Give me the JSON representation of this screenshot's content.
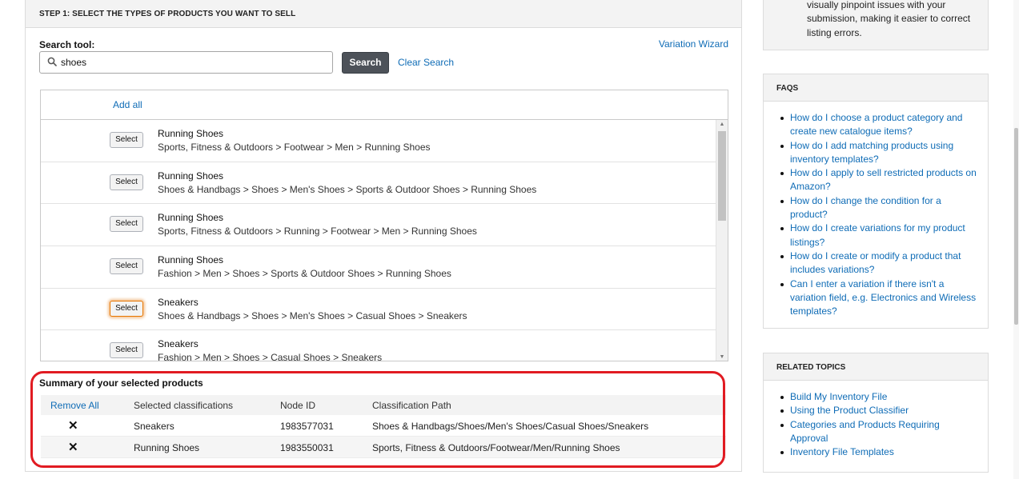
{
  "step": {
    "header": "STEP 1: SELECT THE TYPES OF PRODUCTS YOU WANT TO SELL",
    "search_label": "Search tool:",
    "variation_wizard": "Variation Wizard",
    "search_value": "shoes",
    "search_button": "Search",
    "clear_search": "Clear Search"
  },
  "results": {
    "add_all": "Add all",
    "select_label": "Select",
    "items": [
      {
        "name": "Running Shoes",
        "path": "Sports, Fitness & Outdoors > Footwear > Men > Running Shoes"
      },
      {
        "name": "Running Shoes",
        "path": "Shoes & Handbags > Shoes > Men's Shoes > Sports & Outdoor Shoes > Running Shoes"
      },
      {
        "name": "Running Shoes",
        "path": "Sports, Fitness & Outdoors > Running > Footwear > Men > Running Shoes"
      },
      {
        "name": "Running Shoes",
        "path": "Fashion > Men > Shoes > Sports & Outdoor Shoes > Running Shoes"
      },
      {
        "name": "Sneakers",
        "path": "Shoes & Handbags > Shoes > Men's Shoes > Casual Shoes > Sneakers"
      },
      {
        "name": "Sneakers",
        "path": "Fashion > Men > Shoes > Casual Shoes > Sneakers"
      }
    ]
  },
  "summary": {
    "title": "Summary of your selected products",
    "columns": {
      "remove_all": "Remove All",
      "classification": "Selected classifications",
      "node_id": "Node ID",
      "path": "Classification Path"
    },
    "remove_glyph": "✕",
    "rows": [
      {
        "classification": "Sneakers",
        "node_id": "1983577031",
        "path": "Shoes & Handbags/Shoes/Men's Shoes/Casual Shoes/Sneakers"
      },
      {
        "classification": "Running Shoes",
        "node_id": "1983550031",
        "path": "Sports, Fitness & Outdoors/Footwear/Men/Running Shoes"
      }
    ]
  },
  "sidebar": {
    "tip_text": "visually pinpoint issues with your submission, making it easier to correct listing errors.",
    "faqs": {
      "title": "FAQS",
      "items": [
        "How do I choose a product category and create new catalogue items?",
        "How do I add matching products using inventory templates?",
        "How do I apply to sell restricted products on Amazon?",
        "How do I change the condition for a product?",
        "How do I create variations for my product listings?",
        "How do I create or modify a product that includes variations?",
        "Can I enter a variation if there isn't a variation field, e.g. Electronics and Wireless templates?"
      ]
    },
    "related": {
      "title": "RELATED TOPICS",
      "items": [
        "Build My Inventory File",
        "Using the Product Classifier",
        "Categories and Products Requiring Approval",
        "Inventory File Templates"
      ]
    }
  },
  "colors": {
    "link": "#0f6cb6",
    "search_button_bg": "#4d5259",
    "highlight_border": "#e11b22",
    "focus_ring": "#e77600"
  },
  "icons": {
    "search": "magnifier-icon",
    "remove": "close-x-icon",
    "scroll_up": "triangle-up-icon",
    "scroll_down": "triangle-down-icon",
    "bullet": "bullet-dot-icon"
  }
}
